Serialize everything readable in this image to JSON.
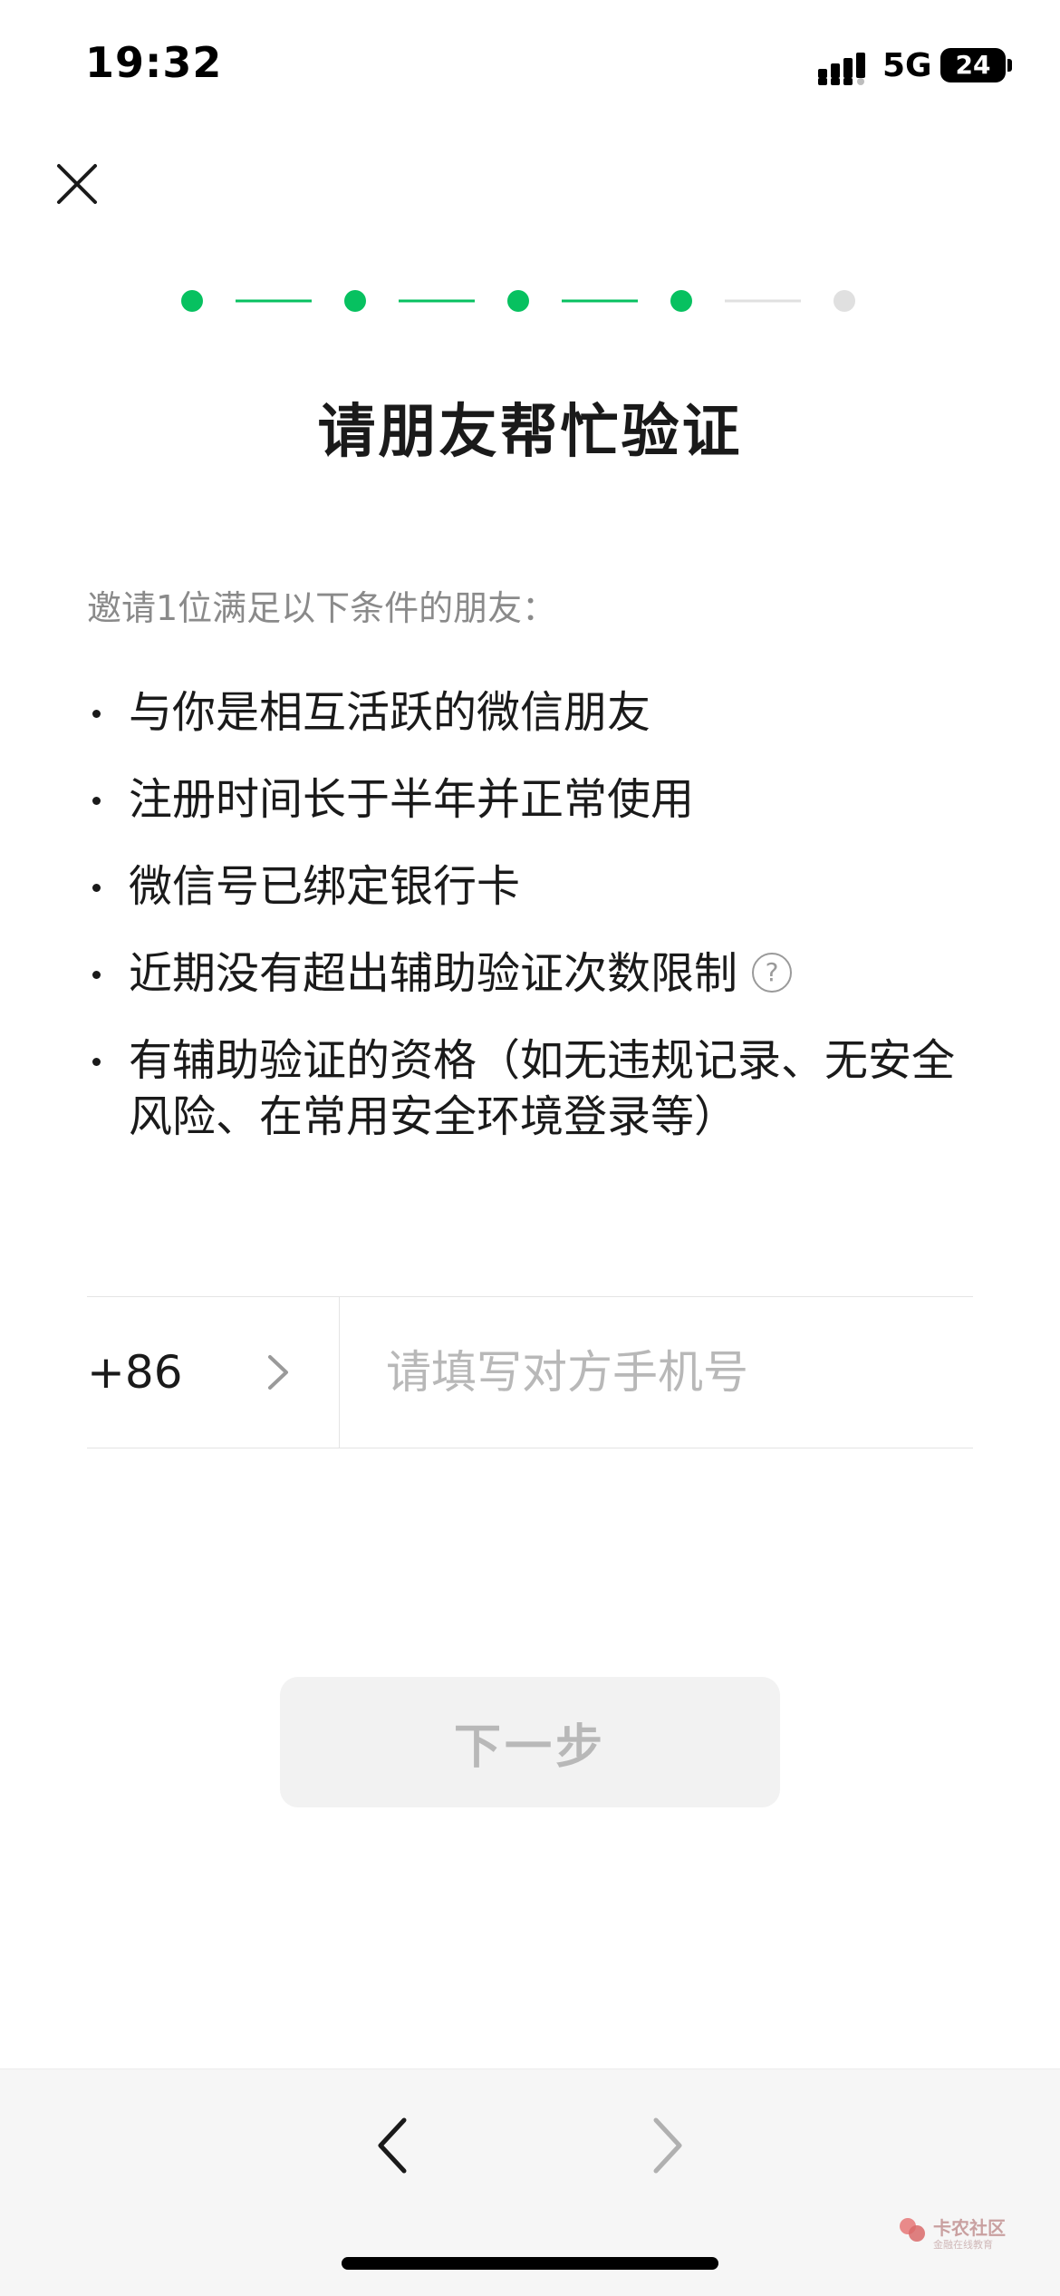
{
  "status_bar": {
    "time": "19:32",
    "network": "5G",
    "battery": "24"
  },
  "progress": {
    "total_steps": 5,
    "completed_steps": 4,
    "active_color": "#07c160",
    "inactive_color": "#e0e0e0"
  },
  "title": "请朋友帮忙验证",
  "intro": "邀请1位满足以下条件的朋友：",
  "conditions": [
    "与你是相互活跃的微信朋友",
    "注册时间长于半年并正常使用",
    "微信号已绑定银行卡",
    "近期没有超出辅助验证次数限制",
    "有辅助验证的资格（如无违规记录、无安全风险、在常用安全环境登录等）"
  ],
  "help_icon_glyph": "?",
  "phone": {
    "country_code": "+86",
    "placeholder": "请填写对方手机号",
    "value": ""
  },
  "next_button": "下一步",
  "watermark": {
    "text": "卡农社区",
    "sub": "金融在线教育"
  },
  "icons": {
    "close": "close-icon",
    "chevron": "chevron-right-icon",
    "back": "chevron-left-icon",
    "forward": "chevron-right-icon",
    "help": "question-circle-icon"
  }
}
